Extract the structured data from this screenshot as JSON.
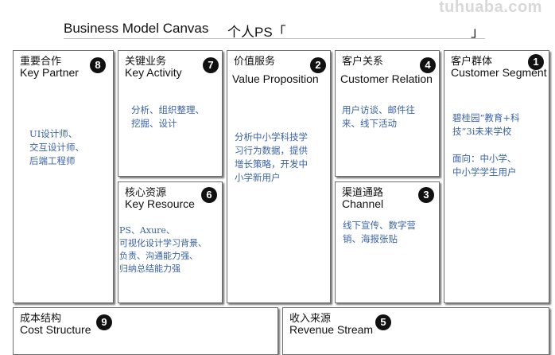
{
  "watermark": "tuhuaba.com",
  "header": {
    "title": "Business Model Canvas",
    "project_label": "个人PS「",
    "project_close": "」"
  },
  "blocks": {
    "key_partner": {
      "cn": "重要合作",
      "en": "Key Partner",
      "num": "8",
      "content": [
        "UI设计师、",
        "交互设计师、",
        "后端工程师"
      ]
    },
    "key_activity": {
      "cn": "关键业务",
      "en": "Key Activity",
      "num": "7",
      "content": [
        "分析、组织整理、",
        "挖掘、设计"
      ]
    },
    "value_proposition": {
      "cn": "价值服务",
      "en": "Value Proposition",
      "num": "2",
      "content": [
        "分析中小学科技学",
        "习行为数据，提供",
        "增长策略，开发中",
        "小学新用户"
      ]
    },
    "customer_relation": {
      "cn": "客户关系",
      "en": "Customer Relation",
      "num": "4",
      "content": [
        "用户访谈、邮件往",
        "来、线下活动"
      ]
    },
    "customer_segment": {
      "cn": "客户群体",
      "en": "Customer Segment",
      "num": "1",
      "content": [
        "碧桂园“教育+科",
        "技”3i未来学校",
        "",
        "面向：中小学、",
        "中小学学生用户"
      ]
    },
    "key_resource": {
      "cn": "核心资源",
      "en": "Key Resource",
      "num": "6",
      "content": [
        "PS、Axure、",
        "可视化设计学习背景、",
        "负责、沟通能力强、",
        "归纳总结能力强"
      ]
    },
    "channel": {
      "cn": "渠道通路",
      "en": "Channel",
      "num": "3",
      "content": [
        "线下宣传、数字营",
        "销、海报张贴"
      ]
    },
    "cost_structure": {
      "cn": "成本结构",
      "en": "Cost Structure",
      "num": "9"
    },
    "revenue_stream": {
      "cn": "收入来源",
      "en": "Revenue Stream",
      "num": "5"
    }
  },
  "colors": {
    "content_text": "#3a63a8",
    "badge_bg": "#111111",
    "border": "#6d6d6d"
  }
}
